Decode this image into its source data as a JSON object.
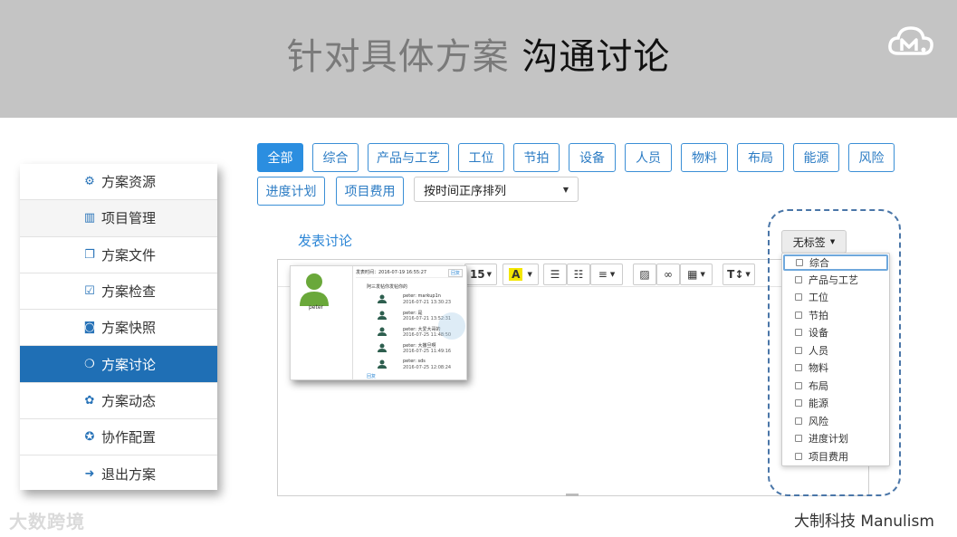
{
  "header": {
    "title_gray": "针对具体方案",
    "title_dark": "沟通讨论",
    "logo_icon": "cloud-m-logo-icon",
    "background": "#c4c4c4"
  },
  "menu": {
    "active_color": "#1f6fb5",
    "items": [
      {
        "label": "方案资源",
        "icon": "gears-icon"
      },
      {
        "label": "项目管理",
        "icon": "bar-chart-icon"
      },
      {
        "label": "方案文件",
        "icon": "files-icon"
      },
      {
        "label": "方案检查",
        "icon": "check-square-icon"
      },
      {
        "label": "方案快照",
        "icon": "camera-icon"
      },
      {
        "label": "方案讨论",
        "icon": "comments-icon",
        "active": true
      },
      {
        "label": "方案动态",
        "icon": "paw-icon"
      },
      {
        "label": "协作配置",
        "icon": "users-cog-icon"
      },
      {
        "label": "退出方案",
        "icon": "sign-out-icon"
      }
    ]
  },
  "filters": {
    "tags_row1": [
      "全部",
      "综合",
      "产品与工艺",
      "工位",
      "节拍",
      "设备",
      "人员",
      "物料",
      "布局",
      "能源",
      "风险"
    ],
    "tags_row2": [
      "进度计划",
      "项目费用"
    ],
    "active_tag": "全部",
    "sort_value": "按时间正序排列"
  },
  "editor": {
    "post_label": "发表讨论",
    "font_size": "15",
    "toolbar_icons": [
      "font-color-icon",
      "bullet-list-icon",
      "numbered-list-icon",
      "align-icon",
      "image-icon",
      "link-icon",
      "table-icon",
      "text-format-icon"
    ]
  },
  "snapshot": {
    "user_name": "peter",
    "head_text": "发表时间：2016-07-19 16:55:27",
    "reply_label": "回复",
    "topic": "阿三发帖你发帖你的",
    "replies": [
      {
        "text": "peter: markup1n",
        "time": "2016-07-21 13:30:23"
      },
      {
        "text": "peter: 是",
        "time": "2016-07-21 13:52:31"
      },
      {
        "text": "peter: 大爱大哥的",
        "time": "2016-07-25 11:48:50"
      },
      {
        "text": "peter: 大撒旦啊",
        "time": "2016-07-25 11:49:16"
      },
      {
        "text": "peter: sds",
        "time": "2016-07-25 12:08:24"
      }
    ],
    "more_label": "回复"
  },
  "label_dropdown": {
    "button_label": "无标签",
    "options": [
      "综合",
      "产品与工艺",
      "工位",
      "节拍",
      "设备",
      "人员",
      "物料",
      "布局",
      "能源",
      "风险",
      "进度计划",
      "项目费用"
    ],
    "focused_option": "综合"
  },
  "footer": {
    "left_watermark": "大数跨境",
    "right_brand": "大制科技 Manulism"
  }
}
